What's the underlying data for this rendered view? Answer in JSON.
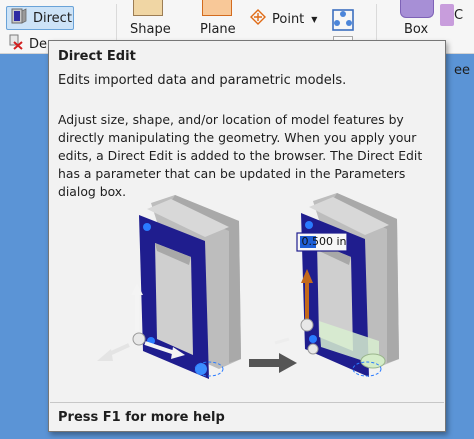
{
  "ribbon": {
    "direct_label": "Direct",
    "delete_label": "De",
    "shape_label": "Shape",
    "plane_label": "Plane",
    "point_label": "Point",
    "box_label": "Box",
    "c_label": "C",
    "ee_label": "ee"
  },
  "tooltip": {
    "title": "Direct Edit",
    "summary": "Edits imported data and parametric models.",
    "description": "Adjust size, shape, and/or location of model features by directly manipulating the geometry. When you apply your edits, a Direct Edit is added to the browser. The Direct Edit has a parameter that can be updated in the Parameters dialog box.",
    "figure": {
      "dimension_value": "0.500 in"
    },
    "footer": "Press F1 for more help"
  },
  "colors": {
    "ribbon_bg": "#f6f6f6",
    "selected_button_bg": "#cde3f7",
    "tooltip_bg": "#f2f2f2",
    "model_face": "#1f1d8e",
    "model_body": "#cfcfcf",
    "desktop_bg": "#5b94d6"
  },
  "icons": {
    "direct": "direct-edit-icon",
    "delete": "delete-face-icon",
    "point": "point-icon",
    "point_caret": "chevron-down-icon",
    "grid": "ucs-icon"
  }
}
